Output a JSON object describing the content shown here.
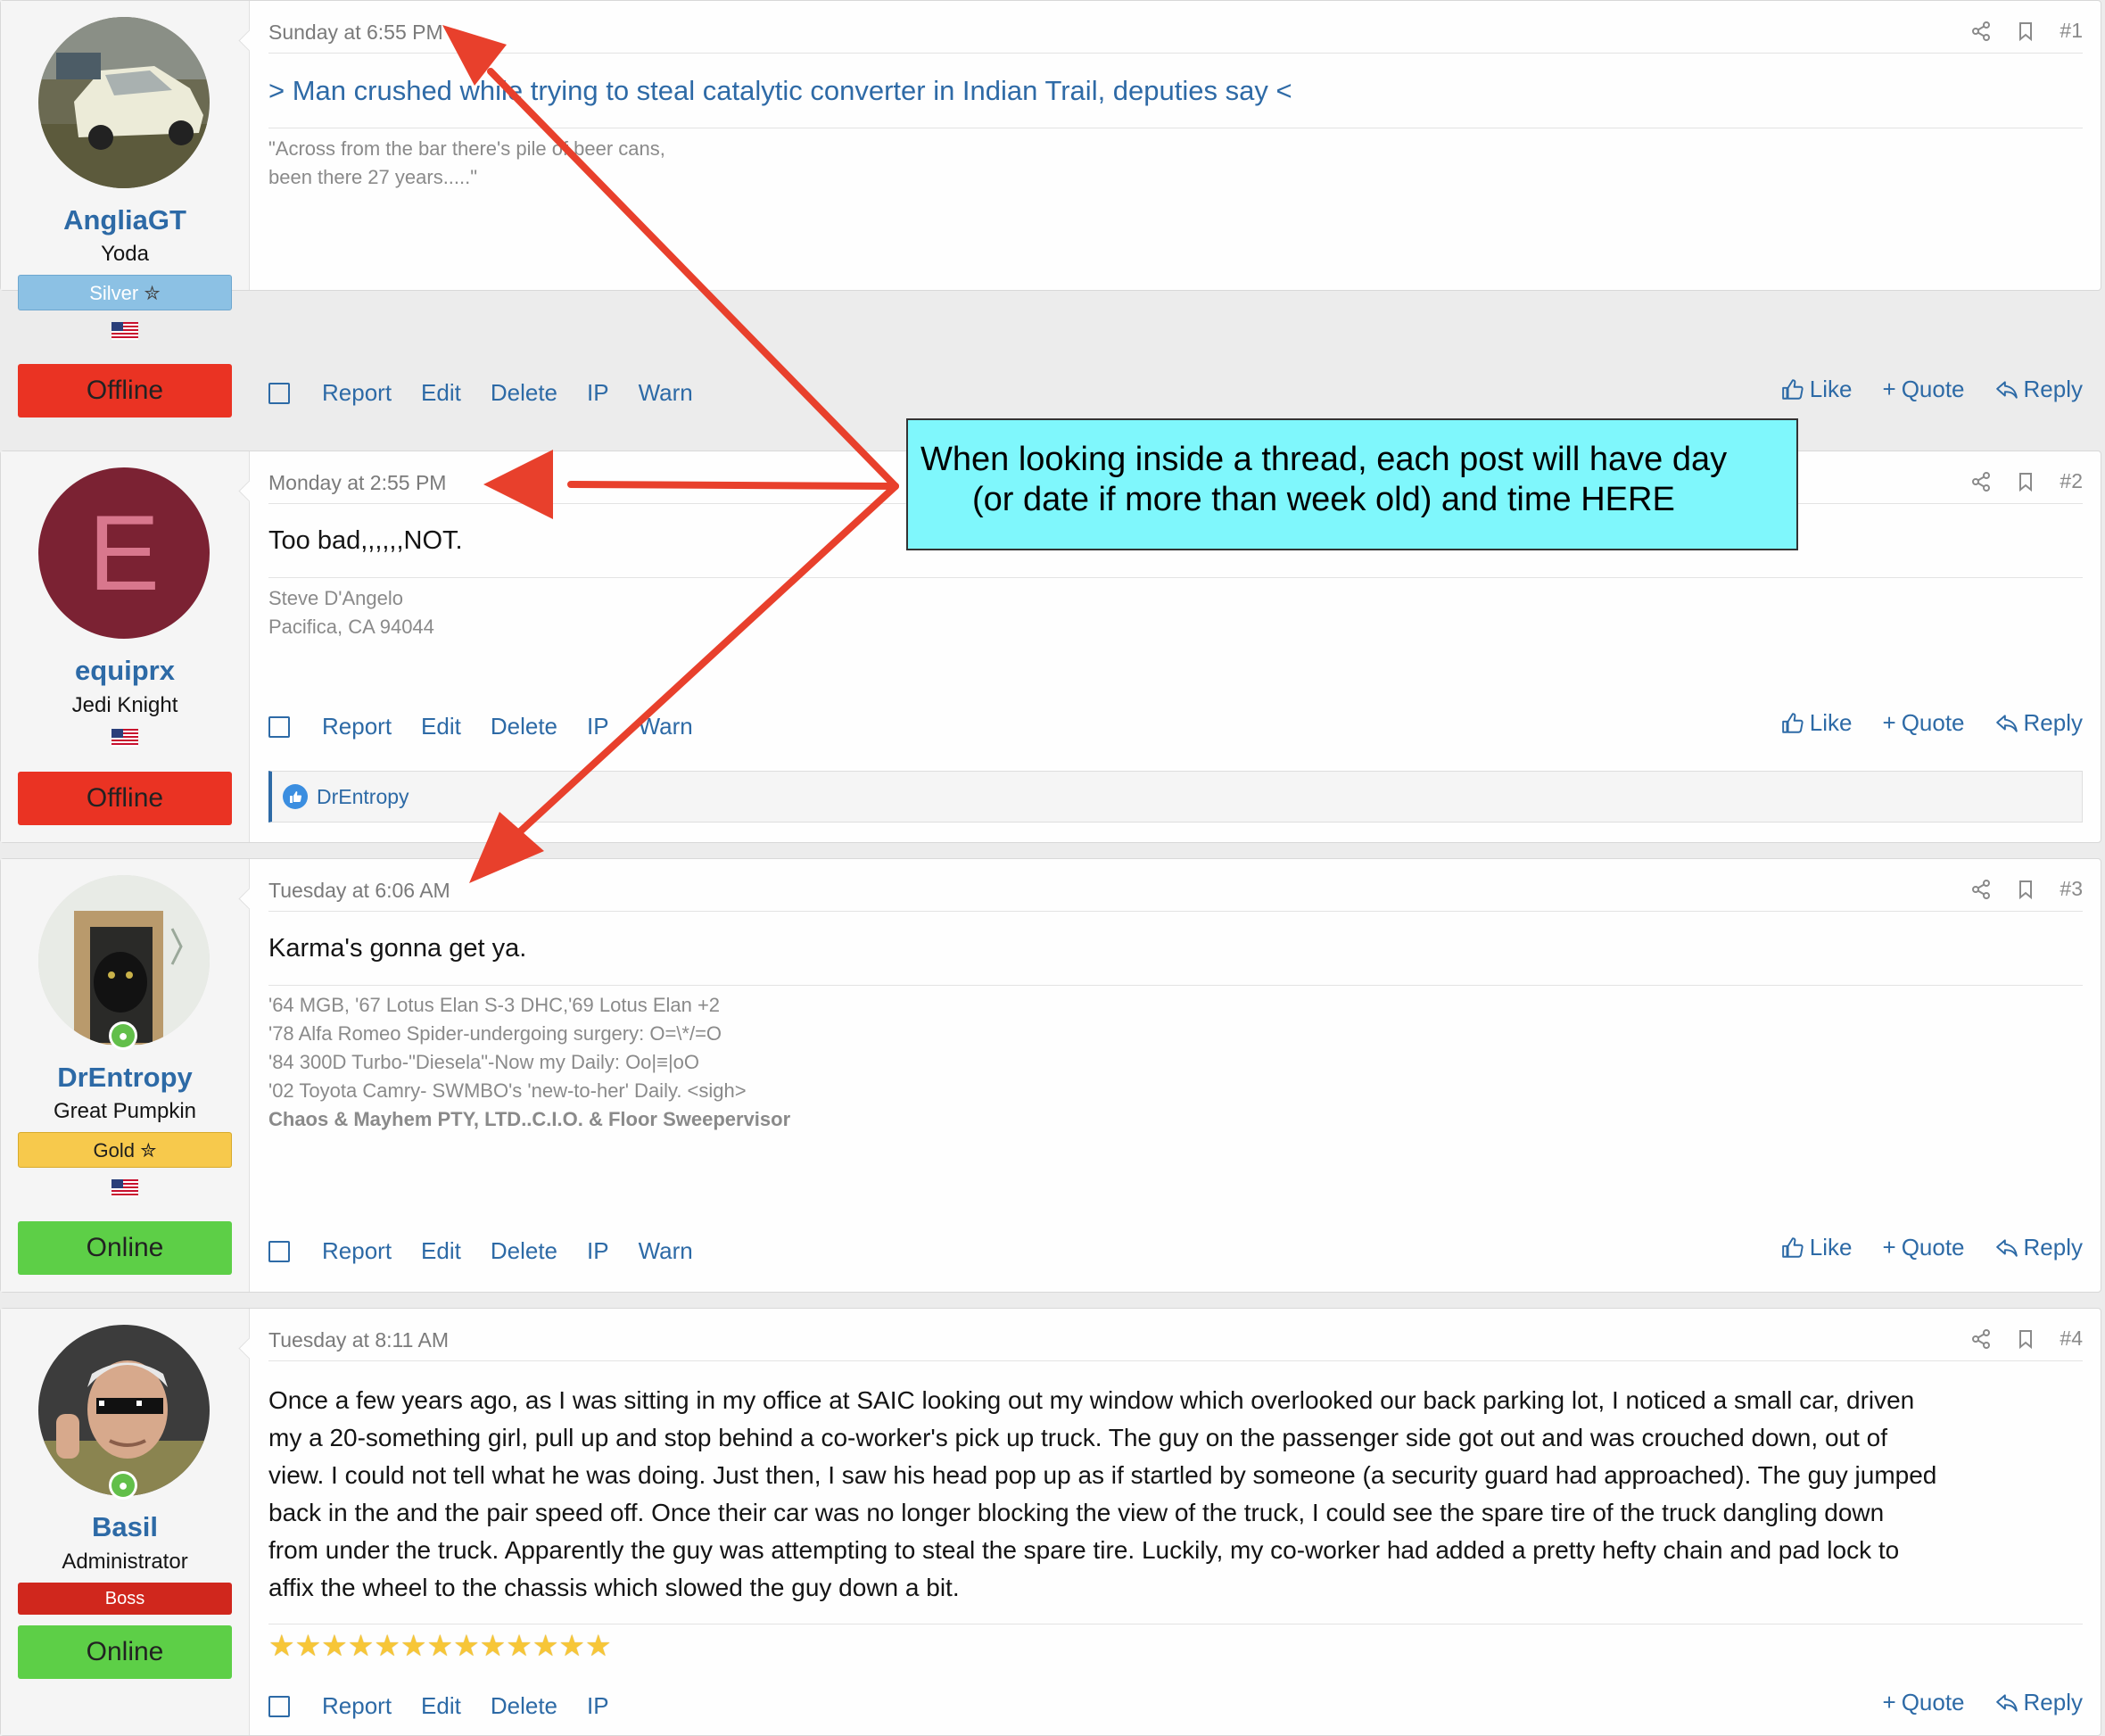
{
  "callout": {
    "line1": "When looking inside a thread, each post will have day",
    "line2": "(or date if more than week old) and time HERE"
  },
  "actions": {
    "report": "Report",
    "edit": "Edit",
    "delete": "Delete",
    "ip": "IP",
    "warn": "Warn",
    "like": "Like",
    "quote": "Quote",
    "reply": "Reply",
    "plus": "+"
  },
  "posts": [
    {
      "user": {
        "name": "AngliaGT",
        "title": "Yoda",
        "banner": "Silver",
        "status": "Offline"
      },
      "date": "Sunday at 6:55 PM",
      "number": "#1",
      "title": "> Man crushed while trying to steal catalytic converter in Indian Trail, deputies say <",
      "sig": [
        "\"Across from the bar there's pile of beer cans,",
        "been there 27 years.....\""
      ]
    },
    {
      "user": {
        "name": "equiprx",
        "title": "Jedi Knight",
        "avatar_letter": "E",
        "status": "Offline"
      },
      "date": "Monday at 2:55 PM",
      "number": "#2",
      "body": "Too bad,,,,,,NOT.",
      "sig": [
        "Steve D'Angelo",
        "Pacifica, CA 94044"
      ],
      "liked_by": "DrEntropy"
    },
    {
      "user": {
        "name": "DrEntropy",
        "title": "Great Pumpkin",
        "banner": "Gold",
        "status": "Online"
      },
      "date": "Tuesday at 6:06 AM",
      "number": "#3",
      "body": "Karma's gonna get ya.",
      "sig": [
        "'64 MGB, '67 Lotus Elan S-3 DHC,'69 Lotus Elan +2",
        "'78 Alfa Romeo Spider-undergoing surgery: O=\\*/=O",
        "'84 300D Turbo-\"Diesela\"-Now my Daily: Oo|≡|oO",
        "'02 Toyota Camry- SWMBO's 'new-to-her' Daily. <sigh>"
      ],
      "sig_bold": "Chaos & Mayhem PTY, LTD..C.I.O. & Floor Sweepervisor"
    },
    {
      "user": {
        "name": "Basil",
        "title": "Administrator",
        "banner": "Boss",
        "status": "Online"
      },
      "date": "Tuesday at 8:11 AM",
      "number": "#4",
      "body_lines": [
        "Once a few years ago, as I was sitting in my office at SAIC looking out my window which overlooked our back parking lot, I noticed a small car, driven",
        "my a 20-something girl, pull up and stop behind a co-worker's pick up truck. The guy on the passenger side got out and was crouched down, out of",
        "view. I could not tell what he was doing. Just then, I saw his head pop up as if startled by someone (a security guard had approached). The guy jumped",
        "back in the and the pair speed off. Once their car was no longer blocking the view of the truck, I could see the spare tire of the truck dangling down",
        "from under the truck. Apparently the guy was attempting to steal the spare tire. Luckily, my co-worker had added a pretty hefty chain and pad lock to",
        "affix the wheel to the chassis which slowed the guy down a bit."
      ],
      "stars": "★★★★★★★★★★★★★"
    }
  ]
}
